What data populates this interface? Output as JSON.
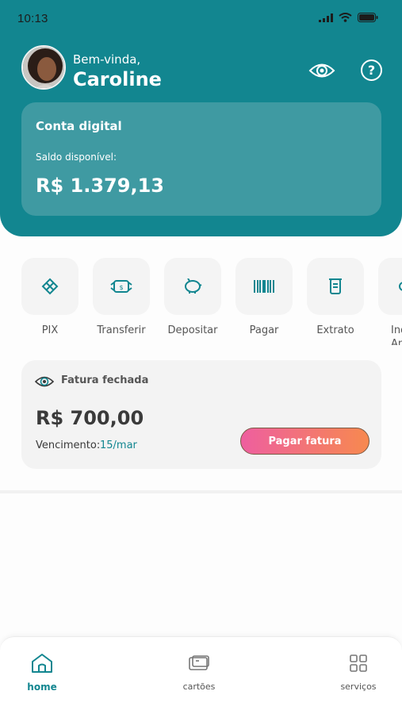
{
  "status_bar": {
    "time": "10:13"
  },
  "header": {
    "greeting": "Bem-vinda,",
    "user_name": "Caroline",
    "brand_color": "#128690"
  },
  "account": {
    "title": "Conta digital",
    "balance_label": "Saldo disponível:",
    "balance_value": "R$ 1.379,13"
  },
  "quick_actions": [
    {
      "label": "PIX",
      "icon": "pix-icon"
    },
    {
      "label": "Transferir",
      "icon": "money-transfer-icon"
    },
    {
      "label": "Depositar",
      "icon": "piggy-bank-icon"
    },
    {
      "label": "Pagar",
      "icon": "barcode-icon"
    },
    {
      "label": "Extrato",
      "icon": "receipt-icon"
    },
    {
      "label": "Ind\nAm",
      "icon": "invite-icon"
    }
  ],
  "invoice": {
    "title": "Fatura fechada",
    "value": "R$ 700,00",
    "due_label": "Vencimento:",
    "due_date": "15/mar",
    "pay_button": "Pagar fatura",
    "button_gradient": [
      "#ee5f9f",
      "#f7894f"
    ]
  },
  "bottom_nav": [
    {
      "label": "home",
      "icon": "home-icon",
      "active": true
    },
    {
      "label": "cartões",
      "icon": "card-icon",
      "active": false
    },
    {
      "label": "serviços",
      "icon": "grid-icon",
      "active": false
    }
  ]
}
